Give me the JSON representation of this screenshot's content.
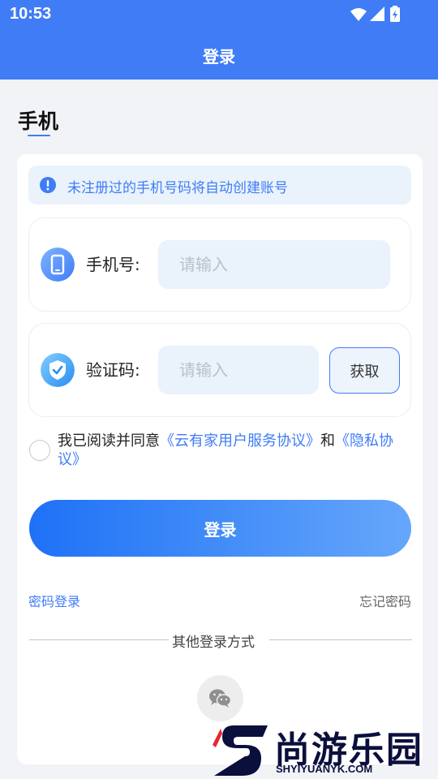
{
  "status_bar": {
    "time": "10:53",
    "icons": [
      "wifi-icon",
      "signal-icon",
      "battery-charging-icon"
    ]
  },
  "app_bar": {
    "title": "登录"
  },
  "tab": {
    "label": "手机"
  },
  "notice": {
    "icon": "info-icon",
    "text": "未注册过的手机号码将自动创建账号"
  },
  "phone_field": {
    "icon": "mobile-phone-icon",
    "label": "手机号:",
    "placeholder": "请输入",
    "value": ""
  },
  "code_field": {
    "icon": "shield-check-icon",
    "label": "验证码:",
    "placeholder": "请输入",
    "value": "",
    "button_label": "获取"
  },
  "agreement": {
    "checked": false,
    "prefix": "我已阅读并同意",
    "service_link": "《云有家用户服务协议》",
    "joiner": "和",
    "privacy_link": "《隐私协议》"
  },
  "login_button": "登录",
  "links": {
    "password_login": "密码登录",
    "forgot_password": "忘记密码"
  },
  "other_methods": {
    "label": "其他登录方式",
    "methods": [
      "wechat-icon"
    ]
  },
  "watermark": {
    "text": "尚游乐园",
    "url": "SHYIYUANYK.COM"
  },
  "colors": {
    "primary": "#3f7cf6",
    "background": "#f2f3f6",
    "input_bg": "#eaf2fb",
    "notice_bg": "#eaf3fb"
  }
}
